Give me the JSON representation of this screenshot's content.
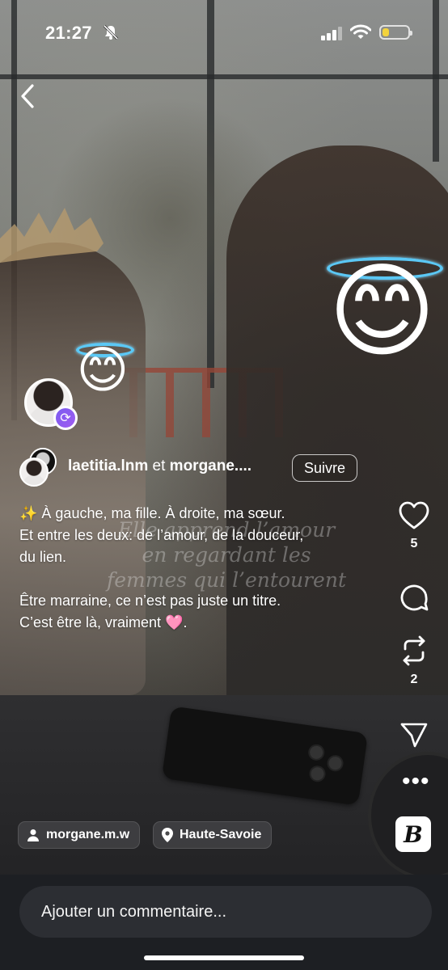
{
  "status_bar": {
    "time": "21:27",
    "battery_level": 0.25
  },
  "post": {
    "authors": [
      {
        "username": "laetitia.lnm"
      },
      {
        "username": "morgane...."
      }
    ],
    "author_joiner": "et",
    "follow_label": "Suivre",
    "caption_lines": [
      "✨ À gauche, ma fille. À droite, ma sœur.",
      "Et entre les deux: de l’amour, de la douceur,",
      "du lien.",
      "Être marraine, ce n’est pas juste un titre.",
      "C’est être là, vraiment 🩷."
    ],
    "image_overlay_text": [
      "Elle apprend l’amour",
      "en regardant les",
      "femmes qui l’entourent"
    ],
    "tagged_user": "morgane.m.w",
    "location": "Haute-Savoie"
  },
  "actions": {
    "like_count": "5",
    "repost_count": "2"
  },
  "icons": {
    "back": "chevron-left-icon",
    "like": "heart-icon",
    "comment": "comment-bubble-icon",
    "repost": "repost-icon",
    "share": "send-icon",
    "more": "more-dots-icon",
    "person": "person-icon",
    "location": "location-pin-icon",
    "mute": "bell-slash-icon"
  },
  "comment_bar": {
    "placeholder": "Ajouter un commentaire..."
  },
  "colors": {
    "repost_badge": "#8a5cf0",
    "halo": "#5bc8f5",
    "battery": "#f3d33d"
  }
}
